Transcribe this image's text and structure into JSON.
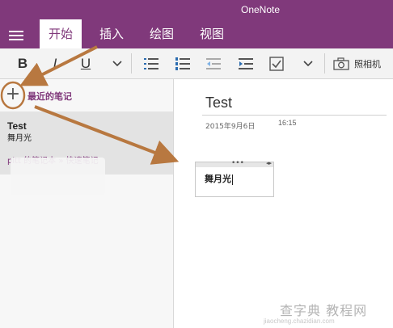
{
  "app": {
    "title": "OneNote"
  },
  "tabs": [
    {
      "label": "开始",
      "active": true
    },
    {
      "label": "插入",
      "active": false
    },
    {
      "label": "绘图",
      "active": false
    },
    {
      "label": "视图",
      "active": false
    }
  ],
  "ribbon": {
    "bold_label": "B",
    "italic_label": "I",
    "underline_label": "U",
    "camera_label": "照相机"
  },
  "sidebar": {
    "recent_label": "最近的笔记",
    "note": {
      "title": "Test",
      "preview": "舞月光",
      "path": "pitt 的笔记本 » 快速笔记"
    }
  },
  "page": {
    "title": "Test",
    "date": "2015年9月6日",
    "time": "16:15",
    "container_text": "舞月光"
  },
  "watermark": {
    "text": "查字典 教程网",
    "url": "jiaocheng.chazidian.com"
  },
  "colors": {
    "brand": "#80397b",
    "annotation": "#b87840"
  }
}
